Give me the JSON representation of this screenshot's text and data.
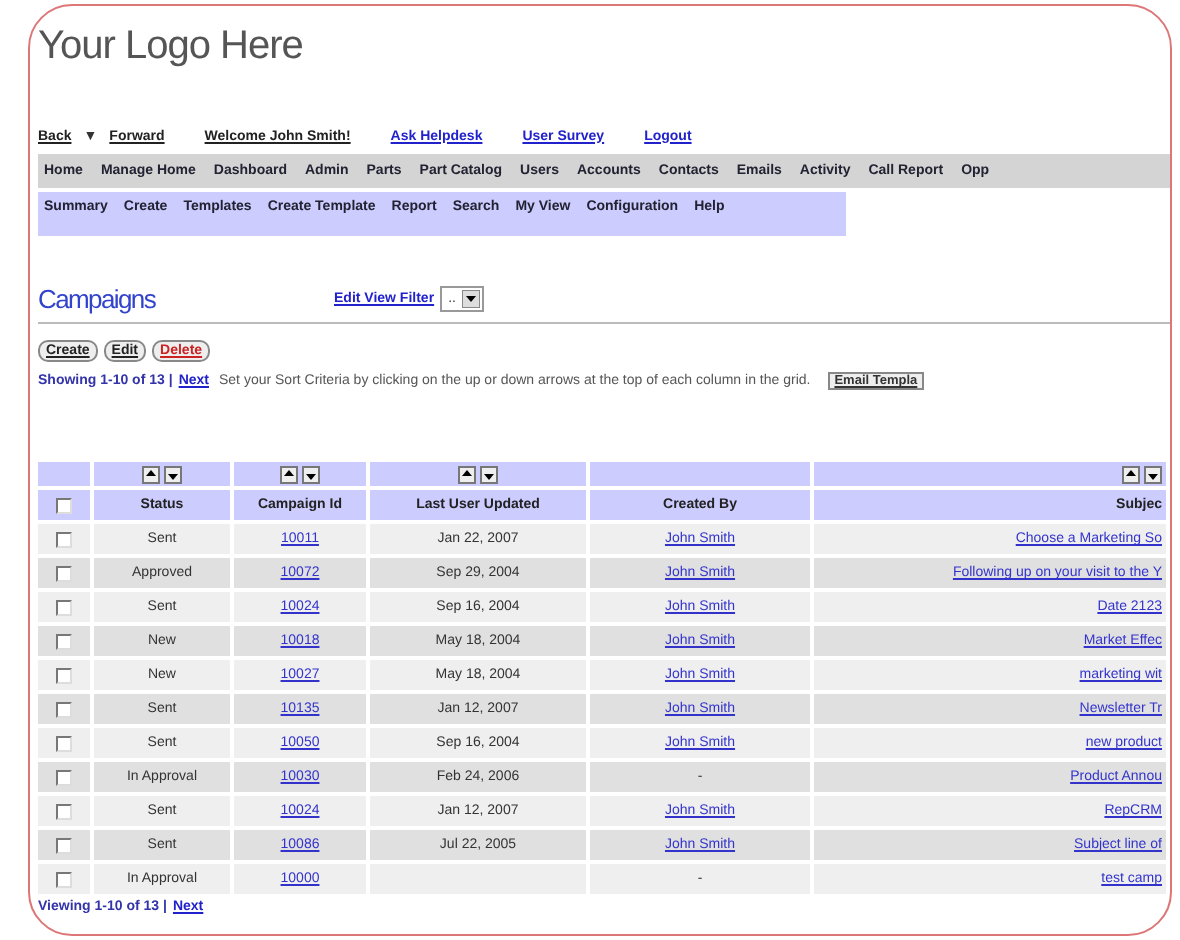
{
  "logo": "Your Logo Here",
  "top_links": [
    {
      "label": "Back",
      "kind": "plain"
    },
    {
      "label": "▼",
      "kind": "caret"
    },
    {
      "label": "Forward",
      "kind": "plain"
    },
    {
      "label": "Welcome John Smith!",
      "kind": "plain"
    },
    {
      "label": "Ask Helpdesk",
      "kind": "link"
    },
    {
      "label": "User Survey",
      "kind": "link"
    },
    {
      "label": "Logout",
      "kind": "link"
    }
  ],
  "nav": [
    "Home",
    "Manage Home",
    "Dashboard",
    "Admin",
    "Parts",
    "Part Catalog",
    "Users",
    "Accounts",
    "Contacts",
    "Emails",
    "Activity",
    "Call Report",
    "Opp"
  ],
  "subnav": [
    "Summary",
    "Create",
    "Templates",
    "Create Template",
    "Report",
    "Search",
    "My View",
    "Configuration",
    "Help"
  ],
  "page_title": "Campaigns",
  "filter": {
    "link": "Edit View Filter",
    "value": ".."
  },
  "actions": [
    {
      "label": "Create",
      "kind": "normal"
    },
    {
      "label": "Edit",
      "kind": "normal"
    },
    {
      "label": "Delete",
      "kind": "danger"
    }
  ],
  "paging": {
    "showing": "Showing 1-10 of 13 |",
    "next": "Next",
    "hint": "Set your Sort Criteria by clicking on the up or down arrows at the top of each column in the grid.",
    "email_button": "Email Templa"
  },
  "table": {
    "header_checked": false,
    "columns": [
      {
        "label": "Status",
        "sortable": true
      },
      {
        "label": "Campaign Id",
        "sortable": true
      },
      {
        "label": "Last User Updated",
        "sortable": true
      },
      {
        "label": "Created By",
        "sortable": false
      },
      {
        "label": "Subjec",
        "sortable": true
      }
    ],
    "rows": [
      {
        "checked": false,
        "status": "Sent",
        "id": "10011",
        "date": "Jan 22, 2007",
        "created_by": "John Smith",
        "subject": "Choose a Marketing So"
      },
      {
        "checked": false,
        "status": "Approved",
        "id": "10072",
        "date": "Sep 29, 2004",
        "created_by": "John Smith",
        "subject": "Following up on your visit to the Y"
      },
      {
        "checked": false,
        "status": "Sent",
        "id": "10024",
        "date": "Sep 16, 2004",
        "created_by": "John Smith",
        "subject": "Date 2123"
      },
      {
        "checked": false,
        "status": "New",
        "id": "10018",
        "date": "May 18, 2004",
        "created_by": "John Smith",
        "subject": "Market Effec"
      },
      {
        "checked": false,
        "status": "New",
        "id": "10027",
        "date": "May 18, 2004",
        "created_by": "John Smith",
        "subject": "marketing wit"
      },
      {
        "checked": false,
        "status": "Sent",
        "id": "10135",
        "date": "Jan 12, 2007",
        "created_by": "John Smith",
        "subject": "Newsletter Tr"
      },
      {
        "checked": false,
        "status": "Sent",
        "id": "10050",
        "date": "Sep 16, 2004",
        "created_by": "John Smith",
        "subject": "new product"
      },
      {
        "checked": false,
        "status": "In Approval",
        "id": "10030",
        "date": "Feb 24, 2006",
        "created_by": "-",
        "subject": "Product Annou"
      },
      {
        "checked": false,
        "status": "Sent",
        "id": "10024",
        "date": "Jan 12, 2007",
        "created_by": "John Smith",
        "subject": "RepCRM"
      },
      {
        "checked": false,
        "status": "Sent",
        "id": "10086",
        "date": "Jul 22, 2005",
        "created_by": "John Smith",
        "subject": "Subject line of"
      },
      {
        "checked": false,
        "status": "In Approval",
        "id": "10000",
        "created_by": "-",
        "subject": "test camp"
      }
    ]
  },
  "footer": {
    "showing": "Viewing 1-10 of 13 |",
    "next": "Next"
  }
}
